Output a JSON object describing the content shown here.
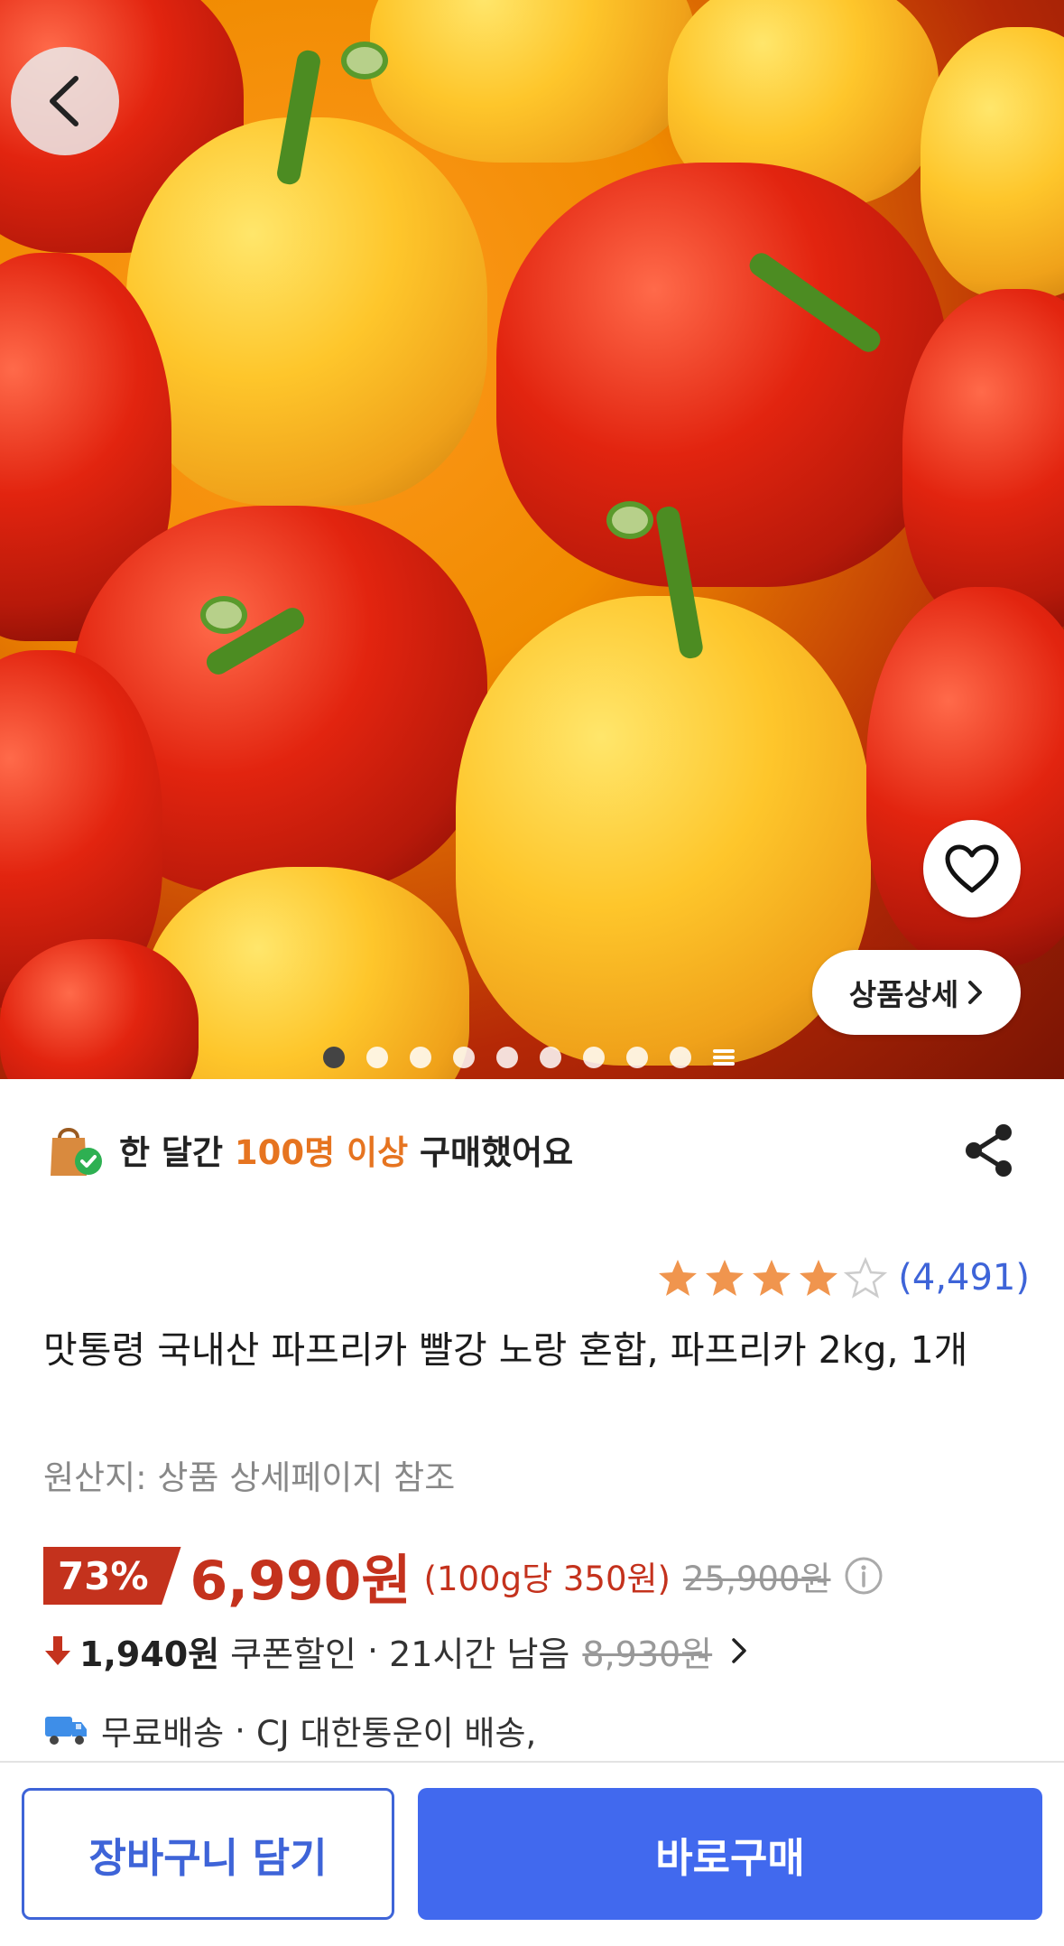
{
  "hero": {
    "image_alt": "red and yellow bell peppers",
    "detail_label": "상품상세",
    "dots_total": 9,
    "dots_active": 1
  },
  "bought": {
    "prefix": "한 달간 ",
    "highlight": "100명 이상",
    "suffix": " 구매했어요"
  },
  "rating": {
    "stars": 4,
    "count_text": "(4,491)"
  },
  "product": {
    "title": "맛통령 국내산 파프리카 빨강 노랑 혼합, 파프리카 2kg, 1개",
    "origin": "원산지: 상품 상세페이지 참조"
  },
  "price": {
    "discount": "73%",
    "final": "6,990원",
    "unit": "(100g당 350원)",
    "original": "25,900원"
  },
  "coupon": {
    "amount": "1,940원",
    "label": "쿠폰할인",
    "sep": "·",
    "time_left": "21시간 남음",
    "previous": "8,930원"
  },
  "shipping": {
    "label": "무료배송",
    "sep": "·",
    "carrier": "CJ 대한통운이 배송,"
  },
  "buttons": {
    "cart": "장바구니 담기",
    "buy": "바로구매"
  },
  "colors": {
    "accent_blue": "#4169ee",
    "price_red": "#c4321d",
    "highlight_orange": "#e67420",
    "star_orange": "#f0954e"
  }
}
